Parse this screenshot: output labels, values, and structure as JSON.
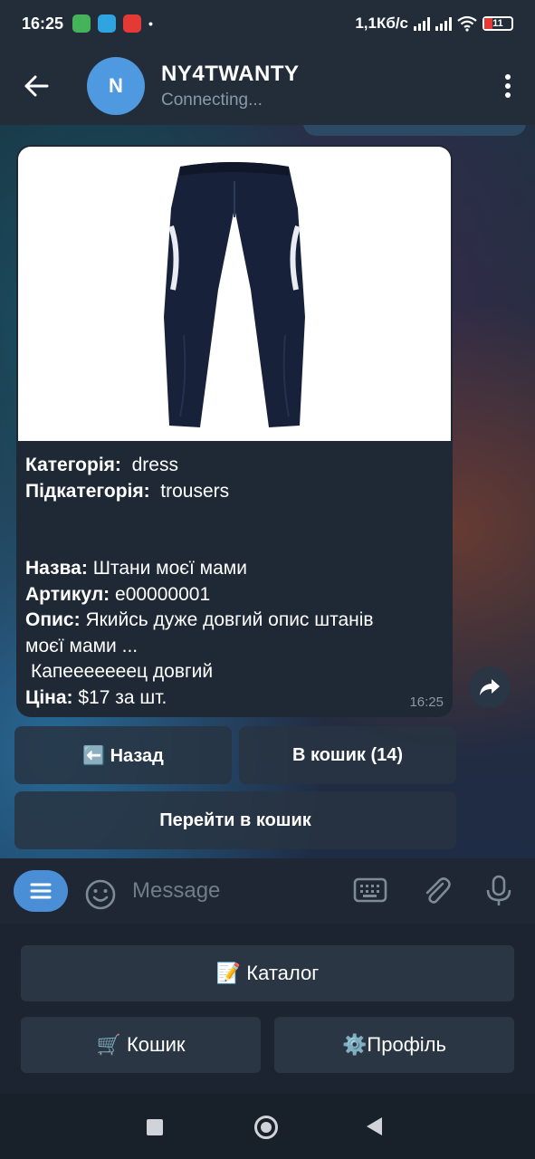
{
  "status": {
    "time": "16:25",
    "speed": "1,1Кб/с",
    "battery": "11"
  },
  "header": {
    "avatar_letter": "N",
    "title": "NY4TWANTY",
    "subtitle": "Connecting..."
  },
  "message": {
    "category_label": "Категорія:",
    "category_value": "dress",
    "subcategory_label": "Підкатегорія:",
    "subcategory_value": "trousers",
    "name_label": "Назва:",
    "name_value": "Штани моєї мами",
    "sku_label": "Артикул:",
    "sku_value": "e00000001",
    "desc_label": "Опис:",
    "desc_value_1": "Якийсь дуже довгий опис штанів",
    "desc_value_2": "моєї мами ...",
    "desc_value_3": "Капееееееец довгий",
    "price_label": "Ціна:",
    "price_value": "$17 за шт.",
    "time": "16:25"
  },
  "inline_keyboard": {
    "back": "⬅️ Назад",
    "cart": "В кошик (14)",
    "go_cart": "Перейти в кошик"
  },
  "input": {
    "placeholder": "Message"
  },
  "reply_keyboard": {
    "catalog": "📝 Каталог",
    "cart": "🛒 Кошик",
    "profile": "⚙️Профіль"
  },
  "colors": {
    "accent": "#4a8fd6",
    "avatar": "#4f99e0",
    "bubble": "#1f2935"
  }
}
